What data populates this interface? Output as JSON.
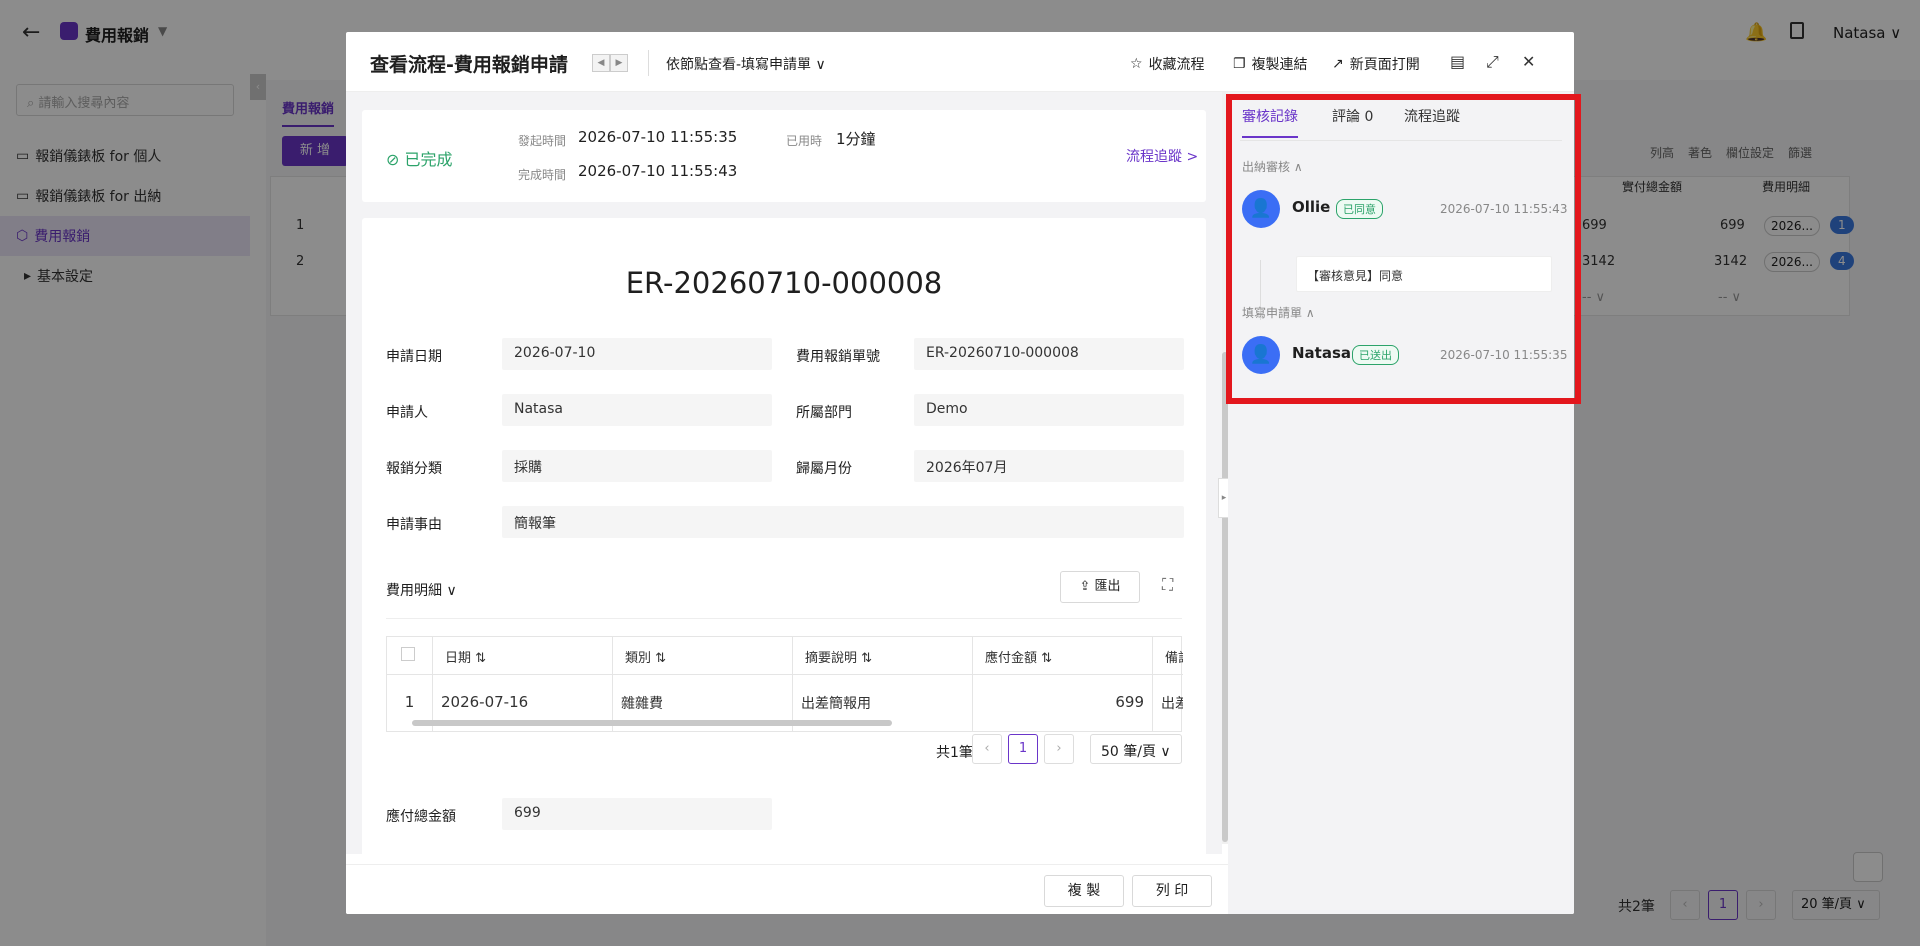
{
  "app": {
    "title": "費用報銷",
    "user": "Natasa"
  },
  "sidebar": {
    "search_placeholder": "請輸入搜尋內容",
    "items": [
      {
        "label": "報銷儀錶板 for 個人"
      },
      {
        "label": "報銷儀錶板 for 出納"
      },
      {
        "label": "費用報銷"
      },
      {
        "label": "基本設定"
      }
    ]
  },
  "background": {
    "tab": "費用報銷",
    "add_button": "新 增",
    "toolbar": [
      "列高",
      "著色",
      "欄位設定",
      "篩選"
    ],
    "columns": [
      "實付總金額",
      "費用明細"
    ],
    "rows": [
      {
        "no": "1",
        "a": "699",
        "b": "699",
        "c": "2026...",
        "badge": "1"
      },
      {
        "no": "2",
        "a": "3142",
        "b": "3142",
        "c": "2026...",
        "badge": "4"
      }
    ],
    "dash1": "-- ∨",
    "dash2": "-- ∨",
    "pager_total": "共2筆",
    "pager_current": "1",
    "pager_size": "20 筆/頁"
  },
  "modal": {
    "title": "查看流程-費用報銷申請",
    "view_node": "依節點查看-填寫申請單",
    "actions": {
      "favorite": "收藏流程",
      "copy_link": "複製連結",
      "open_new": "新頁面打開"
    },
    "status": {
      "state": "已完成",
      "start_label": "發起時間",
      "start_value": "2026-07-10 11:55:35",
      "used_label": "已用時",
      "used_value": "1分鐘",
      "end_label": "完成時間",
      "end_value": "2026-07-10 11:55:43",
      "trace_link": "流程追蹤 >"
    },
    "form": {
      "doc_no": "ER-20260710-000008",
      "fields": {
        "apply_date": {
          "label": "申請日期",
          "value": "2026-07-10"
        },
        "form_no": {
          "label": "費用報銷單號",
          "value": "ER-20260710-000008"
        },
        "applicant": {
          "label": "申請人",
          "value": "Natasa"
        },
        "department": {
          "label": "所屬部門",
          "value": "Demo"
        },
        "category": {
          "label": "報銷分類",
          "value": "採購"
        },
        "month": {
          "label": "歸屬月份",
          "value": "2026年07月"
        },
        "reason": {
          "label": "申請事由",
          "value": "簡報筆"
        },
        "total": {
          "label": "應付總金額",
          "value": "699"
        }
      },
      "detail_title": "費用明細 ∨",
      "export_label": "匯出",
      "detail_columns": [
        "日期",
        "類別",
        "摘要說明",
        "應付金額",
        "備註"
      ],
      "detail_rows": [
        {
          "no": "1",
          "date": "2026-07-16",
          "type": "雜雜費",
          "desc": "出差簡報用",
          "amount": "699",
          "note": "出差"
        }
      ],
      "pager_total": "共1筆",
      "pager_current": "1",
      "pager_size": "50 筆/頁"
    },
    "footer": {
      "copy": "複 製",
      "print": "列 印"
    },
    "review": {
      "tabs": {
        "records": "審核記錄",
        "comments": "評論 0",
        "trace": "流程追蹤"
      },
      "groups": [
        {
          "title": "出納審核 ∧",
          "name": "Ollie",
          "tag": "已同意",
          "time": "2026-07-10 11:55:43",
          "comment": "【審核意見】同意"
        },
        {
          "title": "填寫申請單 ∧",
          "name": "Natasa",
          "tag": "已送出",
          "time": "2026-07-10 11:55:35"
        }
      ]
    }
  },
  "colors": {
    "accent": "#6a35c9",
    "success": "#2ca36a",
    "avatar": "#3b6ef5",
    "highlight": "#e3171d"
  }
}
